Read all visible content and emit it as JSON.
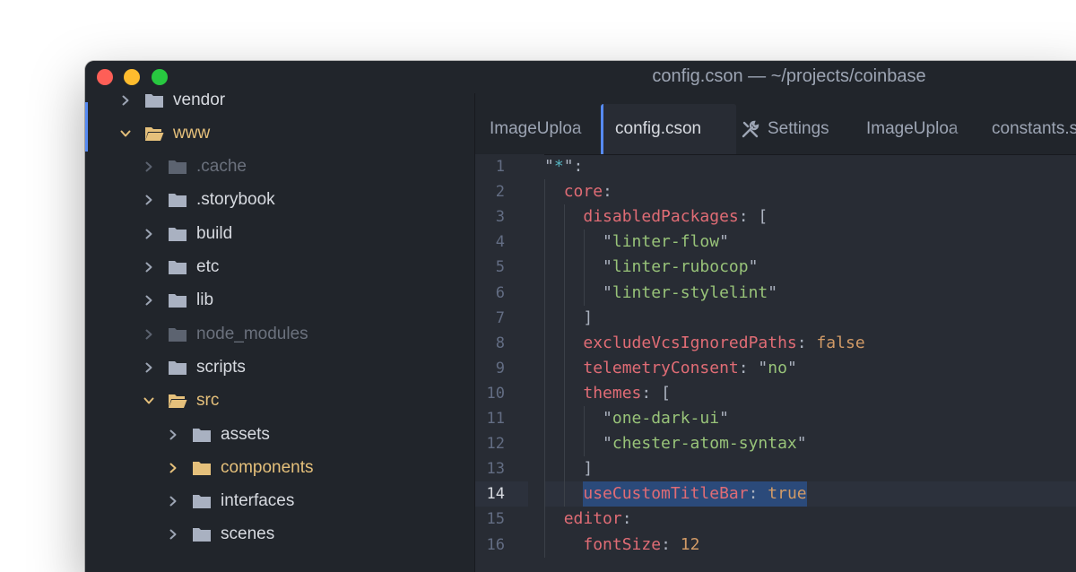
{
  "window": {
    "title": "config.cson — ~/projects/coinbase"
  },
  "tree": [
    {
      "label": "vendor",
      "state": "collapsed",
      "depth": 1,
      "style": "normal"
    },
    {
      "label": "www",
      "state": "expanded",
      "depth": 1,
      "style": "modified"
    },
    {
      "label": ".cache",
      "state": "collapsed",
      "depth": 2,
      "style": "ignored"
    },
    {
      "label": ".storybook",
      "state": "collapsed",
      "depth": 2,
      "style": "normal"
    },
    {
      "label": "build",
      "state": "collapsed",
      "depth": 2,
      "style": "normal"
    },
    {
      "label": "etc",
      "state": "collapsed",
      "depth": 2,
      "style": "normal"
    },
    {
      "label": "lib",
      "state": "collapsed",
      "depth": 2,
      "style": "normal"
    },
    {
      "label": "node_modules",
      "state": "collapsed",
      "depth": 2,
      "style": "ignored"
    },
    {
      "label": "scripts",
      "state": "collapsed",
      "depth": 2,
      "style": "normal"
    },
    {
      "label": "src",
      "state": "expanded",
      "depth": 2,
      "style": "modified"
    },
    {
      "label": "assets",
      "state": "collapsed",
      "depth": 3,
      "style": "normal"
    },
    {
      "label": "components",
      "state": "collapsed",
      "depth": 3,
      "style": "modified"
    },
    {
      "label": "interfaces",
      "state": "collapsed",
      "depth": 3,
      "style": "normal"
    },
    {
      "label": "scenes",
      "state": "collapsed",
      "depth": 3,
      "style": "normal"
    }
  ],
  "tabs": [
    {
      "label": "ImageUploa",
      "active": false,
      "icon": ""
    },
    {
      "label": "config.cson",
      "active": true,
      "icon": ""
    },
    {
      "label": "Settings",
      "active": false,
      "icon": "tools-icon"
    },
    {
      "label": "ImageUploa",
      "active": false,
      "icon": ""
    },
    {
      "label": "constants.s",
      "active": false,
      "icon": ""
    }
  ],
  "editor": {
    "current_line": 14,
    "lines": [
      {
        "n": "1",
        "tokens": [
          [
            "q",
            "\""
          ],
          [
            "star",
            "*"
          ],
          [
            "q",
            "\":"
          ]
        ]
      },
      {
        "n": "2",
        "tokens": [
          [
            "q",
            "  "
          ],
          [
            "k",
            "core"
          ],
          [
            "q",
            ":"
          ]
        ]
      },
      {
        "n": "3",
        "tokens": [
          [
            "q",
            "    "
          ],
          [
            "k",
            "disabledPackages"
          ],
          [
            "q",
            ": ["
          ]
        ]
      },
      {
        "n": "4",
        "tokens": [
          [
            "q",
            "      \""
          ],
          [
            "s",
            "linter-flow"
          ],
          [
            "q",
            "\""
          ]
        ]
      },
      {
        "n": "5",
        "tokens": [
          [
            "q",
            "      \""
          ],
          [
            "s",
            "linter-rubocop"
          ],
          [
            "q",
            "\""
          ]
        ]
      },
      {
        "n": "6",
        "tokens": [
          [
            "q",
            "      \""
          ],
          [
            "s",
            "linter-stylelint"
          ],
          [
            "q",
            "\""
          ]
        ]
      },
      {
        "n": "7",
        "tokens": [
          [
            "q",
            "    ]"
          ]
        ]
      },
      {
        "n": "8",
        "tokens": [
          [
            "q",
            "    "
          ],
          [
            "k",
            "excludeVcsIgnoredPaths"
          ],
          [
            "q",
            ": "
          ],
          [
            "c",
            "false"
          ]
        ]
      },
      {
        "n": "9",
        "tokens": [
          [
            "q",
            "    "
          ],
          [
            "k",
            "telemetryConsent"
          ],
          [
            "q",
            ": \""
          ],
          [
            "s",
            "no"
          ],
          [
            "q",
            "\""
          ]
        ]
      },
      {
        "n": "10",
        "tokens": [
          [
            "q",
            "    "
          ],
          [
            "k",
            "themes"
          ],
          [
            "q",
            ": ["
          ]
        ]
      },
      {
        "n": "11",
        "tokens": [
          [
            "q",
            "      \""
          ],
          [
            "s",
            "one-dark-ui"
          ],
          [
            "q",
            "\""
          ]
        ]
      },
      {
        "n": "12",
        "tokens": [
          [
            "q",
            "      \""
          ],
          [
            "s",
            "chester-atom-syntax"
          ],
          [
            "q",
            "\""
          ]
        ]
      },
      {
        "n": "13",
        "tokens": [
          [
            "q",
            "    ]"
          ]
        ]
      },
      {
        "n": "14",
        "tokens": [
          [
            "q",
            "    "
          ],
          [
            "k",
            "useCustomTitleBar"
          ],
          [
            "q",
            ": "
          ],
          [
            "c",
            "true"
          ]
        ]
      },
      {
        "n": "15",
        "tokens": [
          [
            "q",
            "  "
          ],
          [
            "k",
            "editor"
          ],
          [
            "q",
            ":"
          ]
        ]
      },
      {
        "n": "16",
        "tokens": [
          [
            "q",
            "    "
          ],
          [
            "k",
            "fontSize"
          ],
          [
            "q",
            ": "
          ],
          [
            "c",
            "12"
          ]
        ]
      }
    ]
  },
  "colors": {
    "background": "#21252b",
    "editor_background": "#282c34",
    "accent": "#568af2",
    "keyword": "#e06c75",
    "string": "#98c379",
    "constant": "#d19a66",
    "modified": "#e5c07b"
  }
}
